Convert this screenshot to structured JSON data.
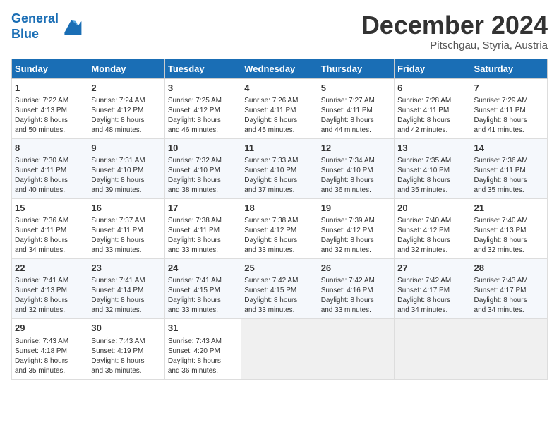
{
  "header": {
    "logo_line1": "General",
    "logo_line2": "Blue",
    "month": "December 2024",
    "location": "Pitschgau, Styria, Austria"
  },
  "weekdays": [
    "Sunday",
    "Monday",
    "Tuesday",
    "Wednesday",
    "Thursday",
    "Friday",
    "Saturday"
  ],
  "weeks": [
    [
      {
        "day": "1",
        "lines": [
          "Sunrise: 7:22 AM",
          "Sunset: 4:13 PM",
          "Daylight: 8 hours",
          "and 50 minutes."
        ]
      },
      {
        "day": "2",
        "lines": [
          "Sunrise: 7:24 AM",
          "Sunset: 4:12 PM",
          "Daylight: 8 hours",
          "and 48 minutes."
        ]
      },
      {
        "day": "3",
        "lines": [
          "Sunrise: 7:25 AM",
          "Sunset: 4:12 PM",
          "Daylight: 8 hours",
          "and 46 minutes."
        ]
      },
      {
        "day": "4",
        "lines": [
          "Sunrise: 7:26 AM",
          "Sunset: 4:11 PM",
          "Daylight: 8 hours",
          "and 45 minutes."
        ]
      },
      {
        "day": "5",
        "lines": [
          "Sunrise: 7:27 AM",
          "Sunset: 4:11 PM",
          "Daylight: 8 hours",
          "and 44 minutes."
        ]
      },
      {
        "day": "6",
        "lines": [
          "Sunrise: 7:28 AM",
          "Sunset: 4:11 PM",
          "Daylight: 8 hours",
          "and 42 minutes."
        ]
      },
      {
        "day": "7",
        "lines": [
          "Sunrise: 7:29 AM",
          "Sunset: 4:11 PM",
          "Daylight: 8 hours",
          "and 41 minutes."
        ]
      }
    ],
    [
      {
        "day": "8",
        "lines": [
          "Sunrise: 7:30 AM",
          "Sunset: 4:11 PM",
          "Daylight: 8 hours",
          "and 40 minutes."
        ]
      },
      {
        "day": "9",
        "lines": [
          "Sunrise: 7:31 AM",
          "Sunset: 4:10 PM",
          "Daylight: 8 hours",
          "and 39 minutes."
        ]
      },
      {
        "day": "10",
        "lines": [
          "Sunrise: 7:32 AM",
          "Sunset: 4:10 PM",
          "Daylight: 8 hours",
          "and 38 minutes."
        ]
      },
      {
        "day": "11",
        "lines": [
          "Sunrise: 7:33 AM",
          "Sunset: 4:10 PM",
          "Daylight: 8 hours",
          "and 37 minutes."
        ]
      },
      {
        "day": "12",
        "lines": [
          "Sunrise: 7:34 AM",
          "Sunset: 4:10 PM",
          "Daylight: 8 hours",
          "and 36 minutes."
        ]
      },
      {
        "day": "13",
        "lines": [
          "Sunrise: 7:35 AM",
          "Sunset: 4:10 PM",
          "Daylight: 8 hours",
          "and 35 minutes."
        ]
      },
      {
        "day": "14",
        "lines": [
          "Sunrise: 7:36 AM",
          "Sunset: 4:11 PM",
          "Daylight: 8 hours",
          "and 35 minutes."
        ]
      }
    ],
    [
      {
        "day": "15",
        "lines": [
          "Sunrise: 7:36 AM",
          "Sunset: 4:11 PM",
          "Daylight: 8 hours",
          "and 34 minutes."
        ]
      },
      {
        "day": "16",
        "lines": [
          "Sunrise: 7:37 AM",
          "Sunset: 4:11 PM",
          "Daylight: 8 hours",
          "and 33 minutes."
        ]
      },
      {
        "day": "17",
        "lines": [
          "Sunrise: 7:38 AM",
          "Sunset: 4:11 PM",
          "Daylight: 8 hours",
          "and 33 minutes."
        ]
      },
      {
        "day": "18",
        "lines": [
          "Sunrise: 7:38 AM",
          "Sunset: 4:12 PM",
          "Daylight: 8 hours",
          "and 33 minutes."
        ]
      },
      {
        "day": "19",
        "lines": [
          "Sunrise: 7:39 AM",
          "Sunset: 4:12 PM",
          "Daylight: 8 hours",
          "and 32 minutes."
        ]
      },
      {
        "day": "20",
        "lines": [
          "Sunrise: 7:40 AM",
          "Sunset: 4:12 PM",
          "Daylight: 8 hours",
          "and 32 minutes."
        ]
      },
      {
        "day": "21",
        "lines": [
          "Sunrise: 7:40 AM",
          "Sunset: 4:13 PM",
          "Daylight: 8 hours",
          "and 32 minutes."
        ]
      }
    ],
    [
      {
        "day": "22",
        "lines": [
          "Sunrise: 7:41 AM",
          "Sunset: 4:13 PM",
          "Daylight: 8 hours",
          "and 32 minutes."
        ]
      },
      {
        "day": "23",
        "lines": [
          "Sunrise: 7:41 AM",
          "Sunset: 4:14 PM",
          "Daylight: 8 hours",
          "and 32 minutes."
        ]
      },
      {
        "day": "24",
        "lines": [
          "Sunrise: 7:41 AM",
          "Sunset: 4:15 PM",
          "Daylight: 8 hours",
          "and 33 minutes."
        ]
      },
      {
        "day": "25",
        "lines": [
          "Sunrise: 7:42 AM",
          "Sunset: 4:15 PM",
          "Daylight: 8 hours",
          "and 33 minutes."
        ]
      },
      {
        "day": "26",
        "lines": [
          "Sunrise: 7:42 AM",
          "Sunset: 4:16 PM",
          "Daylight: 8 hours",
          "and 33 minutes."
        ]
      },
      {
        "day": "27",
        "lines": [
          "Sunrise: 7:42 AM",
          "Sunset: 4:17 PM",
          "Daylight: 8 hours",
          "and 34 minutes."
        ]
      },
      {
        "day": "28",
        "lines": [
          "Sunrise: 7:43 AM",
          "Sunset: 4:17 PM",
          "Daylight: 8 hours",
          "and 34 minutes."
        ]
      }
    ],
    [
      {
        "day": "29",
        "lines": [
          "Sunrise: 7:43 AM",
          "Sunset: 4:18 PM",
          "Daylight: 8 hours",
          "and 35 minutes."
        ]
      },
      {
        "day": "30",
        "lines": [
          "Sunrise: 7:43 AM",
          "Sunset: 4:19 PM",
          "Daylight: 8 hours",
          "and 35 minutes."
        ]
      },
      {
        "day": "31",
        "lines": [
          "Sunrise: 7:43 AM",
          "Sunset: 4:20 PM",
          "Daylight: 8 hours",
          "and 36 minutes."
        ]
      },
      {
        "day": "",
        "lines": []
      },
      {
        "day": "",
        "lines": []
      },
      {
        "day": "",
        "lines": []
      },
      {
        "day": "",
        "lines": []
      }
    ]
  ]
}
